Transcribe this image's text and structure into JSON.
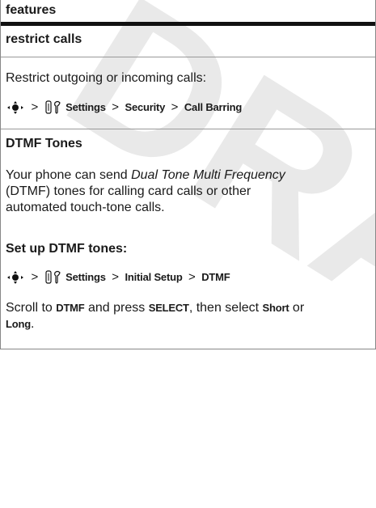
{
  "header": {
    "title": "features"
  },
  "restrict_calls": {
    "title": "restrict calls",
    "description": "Restrict outgoing or incoming calls:",
    "path": {
      "gt": ">",
      "settings": "Settings",
      "security": "Security",
      "call_barring": "Call Barring"
    }
  },
  "dtmf": {
    "title": "DTMF Tones",
    "para_line1_pre": "Your phone can send ",
    "para_line1_em": "Dual Tone Multi Frequency",
    "para_line2": "(DTMF) tones for calling card calls or other",
    "para_line3": "automated touch-tone calls.",
    "setup_title": "Set up DTMF tones:",
    "path": {
      "settings": "Settings",
      "initial_setup": "Initial Setup",
      "dtmf": "DTMF"
    },
    "scroll_pre": "Scroll to ",
    "scroll_dtmf": "DTMF",
    "scroll_mid": " and press ",
    "scroll_select": "SELECT",
    "scroll_post": ", then select ",
    "scroll_short": "Short",
    "scroll_or": " or",
    "scroll_long": "Long",
    "scroll_end": "."
  },
  "watermark": "DRAFT",
  "icons": {
    "nav_key": "navigation-key-icon",
    "settings": "settings-icon"
  }
}
